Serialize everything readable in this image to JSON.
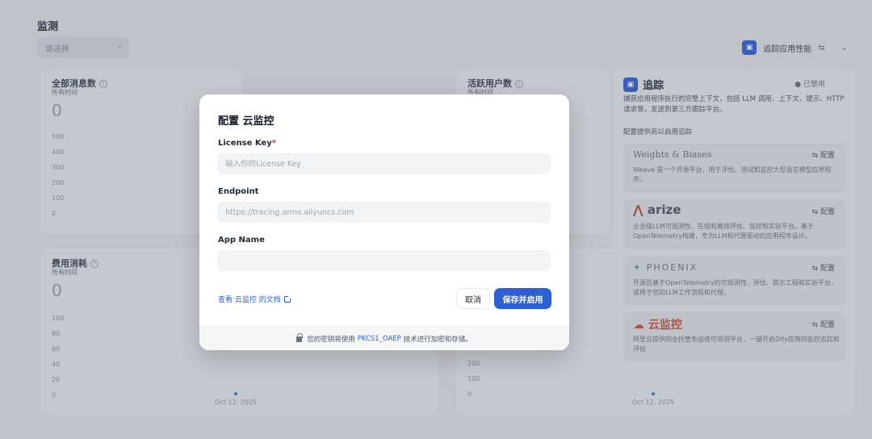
{
  "page": {
    "title": "监测",
    "select_placeholder": "请选择"
  },
  "cards": {
    "messages": {
      "title": "全部消息数",
      "sub": "所有时间",
      "value": "0",
      "ticks": [
        "500",
        "400",
        "300",
        "200",
        "100",
        "0"
      ]
    },
    "active_users": {
      "title": "活跃用户数",
      "sub": "所有时间"
    },
    "cost": {
      "title": "费用消耗",
      "sub": "所有时间",
      "value": "0",
      "ticks": [
        "100",
        "80",
        "60",
        "40",
        "20",
        "0"
      ],
      "date": "Oct 12, 2025"
    },
    "right_chart": {
      "ticks": [
        "200",
        "100",
        "0"
      ],
      "date": "Oct 12, 2025"
    }
  },
  "tracing": {
    "top_label": "追踪应用性能",
    "title": "追踪",
    "status": "已禁用",
    "description": "捕获应用程序执行的完整上下文，包括 LLM 调用、上下文、提示、HTTP 请求等，发送到第三方跟踪平台。",
    "providers_label": "配置提供商以启用追踪",
    "providers": [
      {
        "name": "Weights & Biases",
        "config": "配置",
        "desc": "Weave 是一个开源平台，用于评估、测试和监控大型语言模型应用程序。"
      },
      {
        "name": "arize",
        "config": "配置",
        "desc": "企业级LLM可观测性、在线和离线评估、监控和实验平台。基于OpenTelemetry构建，专为LLM和代理驱动的应用程序设计。"
      },
      {
        "name": "PHOENIX",
        "config": "配置",
        "desc": "开源且基于OpenTelemetry的可观测性、评估、提示工程和实验平台，适用于您的LLM工作流程和代理。"
      },
      {
        "name": "云监控",
        "config": "配置",
        "desc": "阿里云提供的全托管免运维可观测平台，一键开启Dify应用的监控追踪和评估"
      }
    ]
  },
  "modal": {
    "title": "配置 云监控",
    "license_label": "License Key",
    "license_required": "*",
    "license_placeholder": "输入你的License Key",
    "endpoint_label": "Endpoint",
    "endpoint_placeholder": "https://tracing.arms.aliyuncs.com",
    "appname_label": "App Name",
    "appname_value": "",
    "doc_link": "查看 云监控 的文档",
    "cancel": "取消",
    "save": "保存并启用",
    "footer_prefix": "您的密钥将使用",
    "footer_algo": "PKCS1_OAEP",
    "footer_suffix": "技术进行加密和存储。"
  },
  "colors": {
    "primary": "#2f5fd0",
    "required": "#dc2626"
  }
}
